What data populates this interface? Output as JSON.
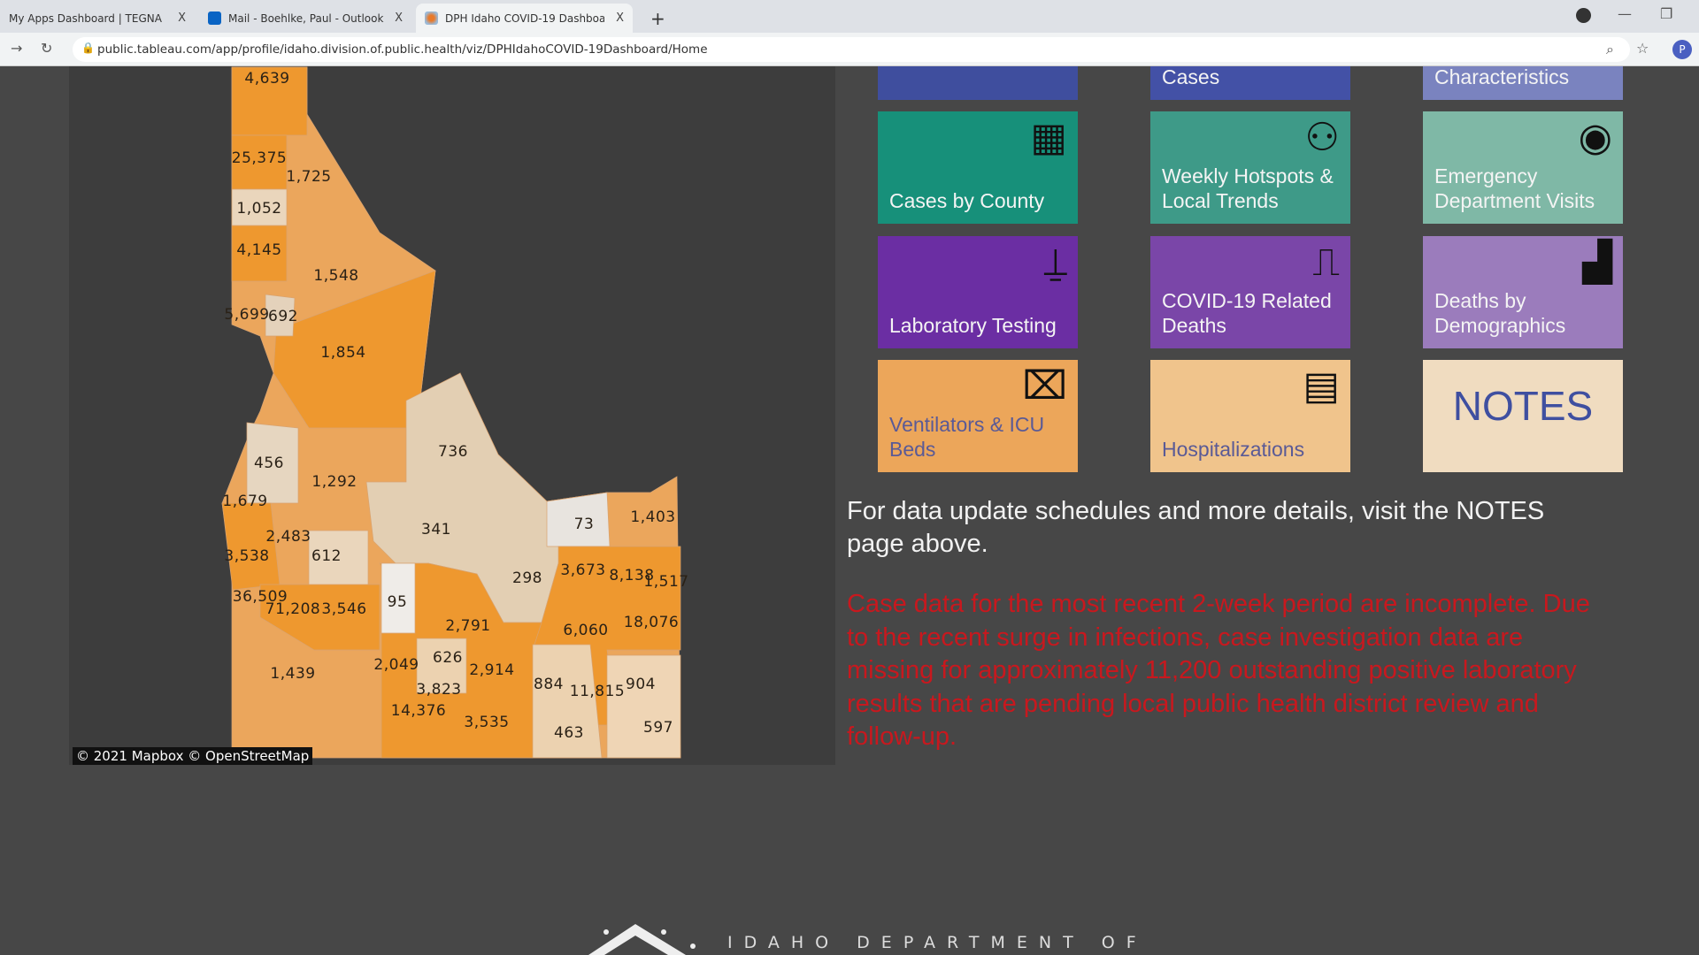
{
  "browser": {
    "tabs": [
      {
        "label": "My Apps Dashboard | TEGNA",
        "active": false
      },
      {
        "label": "Mail - Boehlke, Paul - Outlook",
        "active": false
      },
      {
        "label": "DPH Idaho COVID-19 Dashboard",
        "active": true
      }
    ],
    "close_glyph": "X",
    "new_tab_glyph": "+",
    "url": "public.tableau.com/app/profile/idaho.division.of.public.health/viz/DPHIdahoCOVID-19Dashboard/Home",
    "profile_initial": "P"
  },
  "map": {
    "attribution": "© 2021 Mapbox  © OpenStreetMap",
    "county_values": [
      "4,639",
      "25,375",
      "1,725",
      "1,052",
      "4,145",
      "1,548",
      "5,699",
      "692",
      "1,854",
      "456",
      "736",
      "1,292",
      "1,679",
      "341",
      "2,483",
      "3,538",
      "612",
      "73",
      "1,403",
      "3,673",
      "8,138",
      "1,517",
      "298",
      "36,509",
      "71,208",
      "3,546",
      "95",
      "2,791",
      "6,060",
      "18,076",
      "1,439",
      "2,049",
      "626",
      "2,914",
      "884",
      "11,815",
      "904",
      "3,823",
      "14,376",
      "3,535",
      "463",
      "597"
    ]
  },
  "tiles": [
    {
      "label": "",
      "icon": "chart-icon",
      "color": "#3f4e9e"
    },
    {
      "label": "Cases",
      "icon": "",
      "color": "#4351a6"
    },
    {
      "label": "Characteristics",
      "icon": "",
      "color": "#7a83bf"
    },
    {
      "label": "Cases by County",
      "icon": "map-pin-icon",
      "color": "#17907a"
    },
    {
      "label": "Weekly Hotspots & Local Trends",
      "icon": "network-icon",
      "color": "#3e9a88"
    },
    {
      "label": "Emergency Department Visits",
      "icon": "doctor-icon",
      "color": "#7fb8a6"
    },
    {
      "label": "Laboratory Testing",
      "icon": "test-tube-icon",
      "color": "#6b2ea3"
    },
    {
      "label": "COVID-19 Related Deaths",
      "icon": "heartbeat-monitor-icon",
      "color": "#7a46a8"
    },
    {
      "label": "Deaths by Demographics",
      "icon": "bar-chart-icon",
      "color": "#9b7cbc"
    },
    {
      "label": "Ventilators & ICU Beds",
      "icon": "stretcher-icon",
      "color": "#eca65a"
    },
    {
      "label": "Hospitalizations",
      "icon": "hospital-icon",
      "color": "#f0c48c"
    },
    {
      "label": "NOTES",
      "icon": "notes-icon",
      "color": "#f0dcc0"
    }
  ],
  "info_text": "For data update schedules and more details, visit the NOTES page above.",
  "warning_text": "Case data for the most recent 2-week period are incomplete. Due to the recent surge in infections, case investigation data are missing for approximately 11,200 outstanding positive laboratory results that are pending local public health district review and follow-up.",
  "footer": {
    "text": "IDAHO DEPARTMENT OF"
  }
}
